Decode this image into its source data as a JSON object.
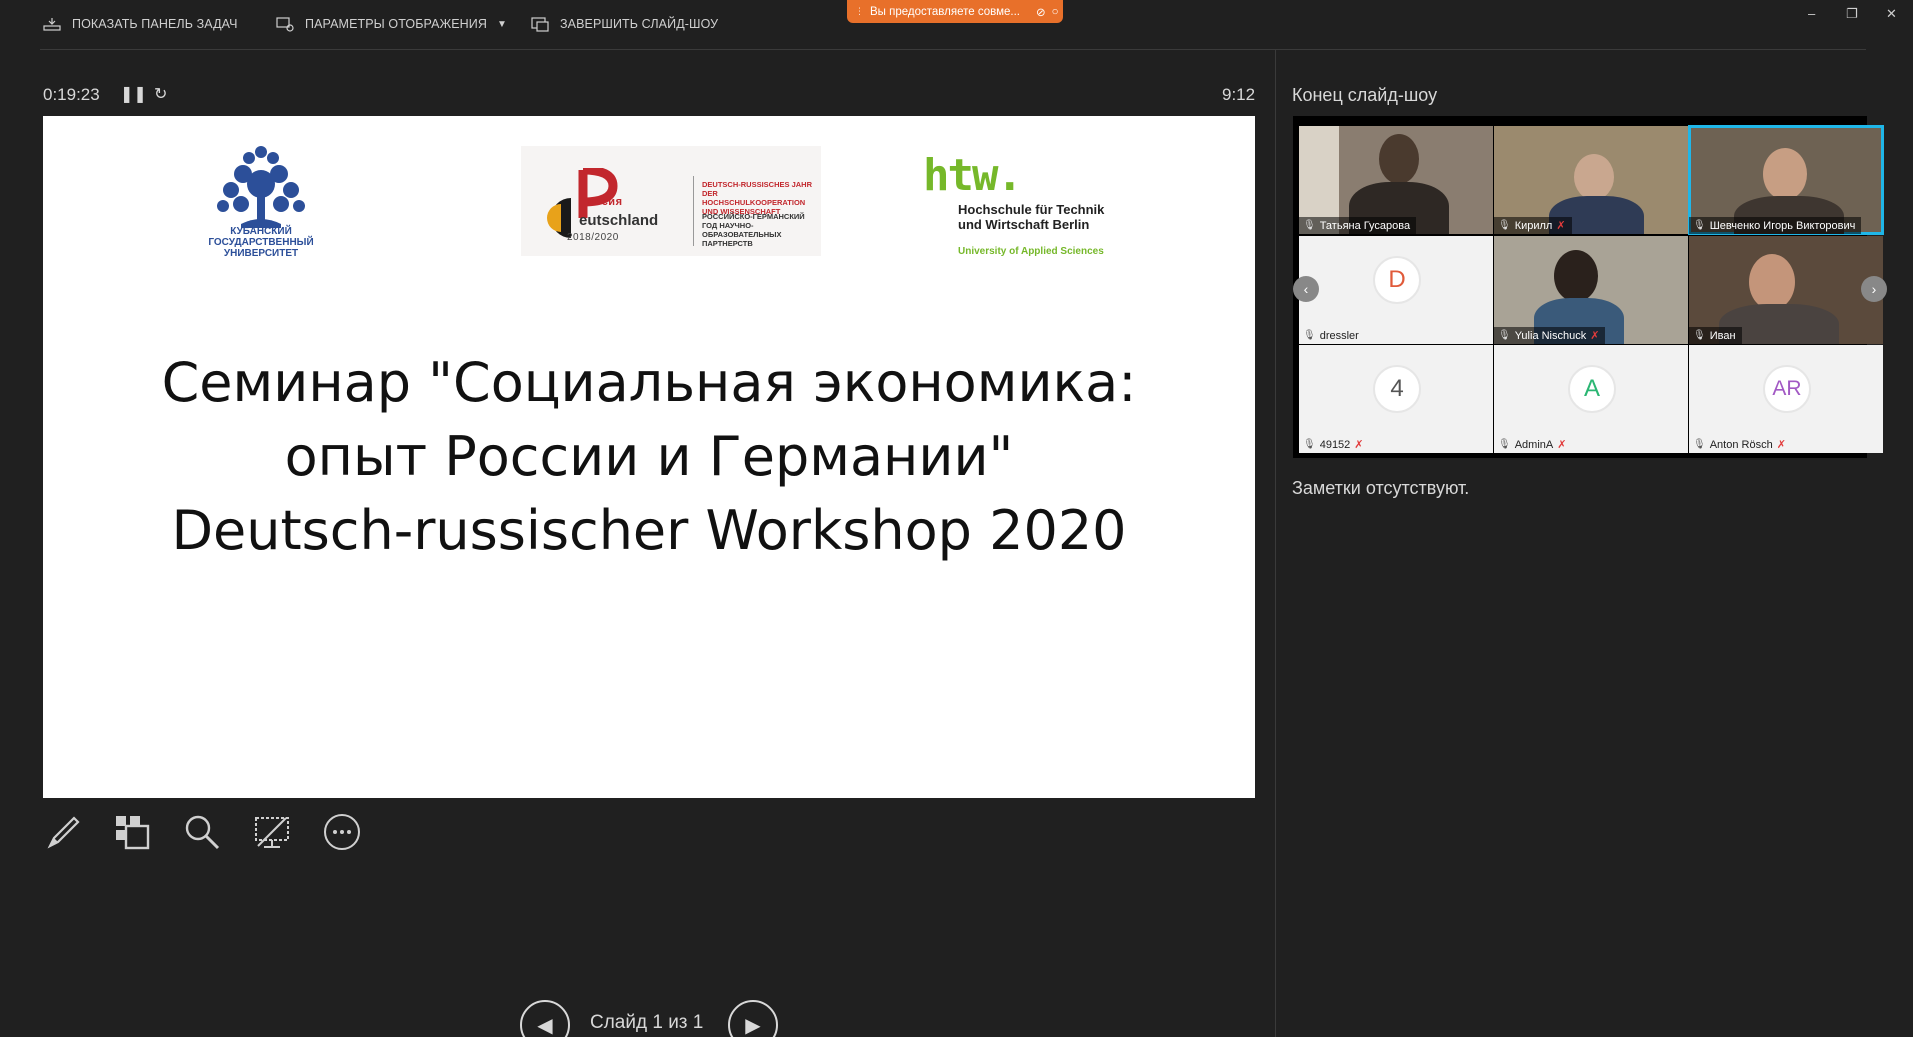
{
  "toolbar": {
    "show_taskbar": "ПОКАЗАТЬ ПАНЕЛЬ ЗАДАЧ",
    "display_settings": "ПАРАМЕТРЫ ОТОБРАЖЕНИЯ",
    "end_show": "ЗАВЕРШИТЬ СЛАЙД-ШОУ",
    "share_notice": "Вы предоставляете совме..."
  },
  "presenter": {
    "elapsed": "0:19:23",
    "clock": "9:12",
    "next_label": "Конец слайд-шоу",
    "notes": "Заметки отсутствуют.",
    "slide_counter": "Слайд 1 из 1"
  },
  "slide": {
    "title_lines": [
      "Семинар \"Социальная экономика:",
      "опыт России и Германии\"",
      "Deutsch-russischer Workshop 2020"
    ],
    "logo_kubgu": "КУБАНСКИЙ ГОСУДАРСТВЕННЫЙ УНИВЕРСИТЕТ",
    "logo_drd_word": "eutschland",
    "logo_drd_rossiya": "оссия",
    "logo_drd_year": "2018/2020",
    "logo_drd_de": "DEUTSCH-RUSSISCHES JAHR DER HOCHSCHULKOOPERATION UND WISSENSCHAFT",
    "logo_drd_ru": "РОССИЙСКО-ГЕРМАНСКИЙ ГОД НАУЧНО-ОБРАЗОВАТЕЛЬНЫХ ПАРТНЕРСТВ",
    "logo_htw_mark": "htw.",
    "logo_htw_name_1": "Hochschule für Technik",
    "logo_htw_name_2": "und Wirtschaft Berlin",
    "logo_htw_sub": "University of Applied Sciences"
  },
  "participants": [
    {
      "name": "Татьяна Гусарова",
      "muted": false,
      "avatar": ""
    },
    {
      "name": "Кирилл",
      "muted": true,
      "avatar": ""
    },
    {
      "name": "Шевченко Игорь Викторович",
      "muted": false,
      "avatar": ""
    },
    {
      "name": "dressler",
      "muted": false,
      "avatar": "D"
    },
    {
      "name": "Yulia Nischuck",
      "muted": true,
      "avatar": ""
    },
    {
      "name": "Иван",
      "muted": false,
      "avatar": ""
    },
    {
      "name": "49152",
      "muted": true,
      "avatar": "4"
    },
    {
      "name": "AdminA",
      "muted": true,
      "avatar": "A"
    },
    {
      "name": "Anton Rösch",
      "muted": true,
      "avatar": "AR"
    }
  ],
  "colors": {
    "accent_share": "#e8702a",
    "htw_green": "#76b82a",
    "kubgu_blue": "#2c4f99",
    "selected_tile": "#1fb6e8",
    "avatar_d": "#e05a3a",
    "avatar_4": "#555555",
    "avatar_a": "#2bb673",
    "avatar_ar": "#a259c4"
  },
  "icons": [
    "taskbar-icon",
    "display-settings-icon",
    "end-show-icon",
    "pause-icon",
    "restart-icon",
    "pen-icon",
    "see-all-slides-icon",
    "zoom-icon",
    "black-screen-icon",
    "more-options-icon",
    "prev-slide-icon",
    "next-slide-icon",
    "mic-icon",
    "muted-icon"
  ]
}
